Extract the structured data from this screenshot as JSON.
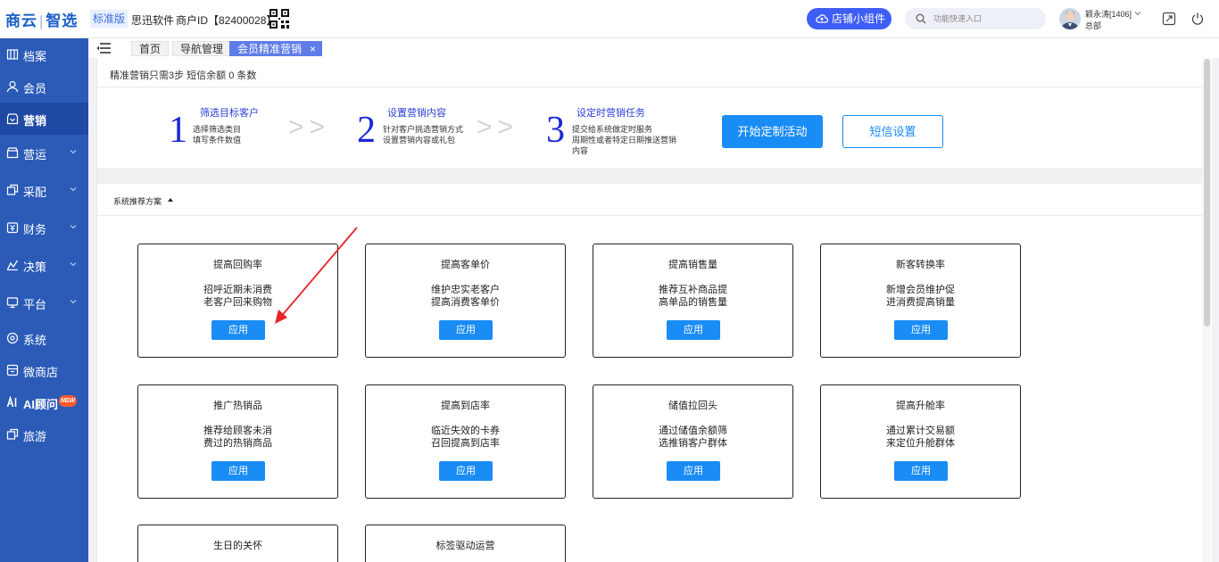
{
  "topbar": {
    "logo_a": "商云",
    "logo_sep": "|",
    "logo_b": "智选",
    "edition": "标准版",
    "company": "思迅软件",
    "merchant": "商户ID【82400028】",
    "widget_label": "店铺小组件",
    "search_placeholder": "功能快速入口",
    "user_name": "颖永涛[1406]",
    "user_dept": "总部"
  },
  "sidebar": {
    "items": [
      {
        "label": "档案",
        "icon": "archive-icon"
      },
      {
        "label": "会员",
        "icon": "user-icon"
      },
      {
        "label": "营销",
        "icon": "marketing-icon"
      },
      {
        "label": "营运",
        "icon": "operations-icon"
      },
      {
        "label": "采配",
        "icon": "purchase-icon"
      },
      {
        "label": "财务",
        "icon": "finance-icon"
      },
      {
        "label": "决策",
        "icon": "decision-icon"
      },
      {
        "label": "平台",
        "icon": "platform-icon"
      },
      {
        "label": "系统",
        "icon": "system-icon"
      },
      {
        "label": "微商店",
        "icon": "microstore-icon"
      },
      {
        "label": "AI顾问",
        "icon": "ai-icon"
      },
      {
        "label": "旅游",
        "icon": "travel-icon"
      }
    ],
    "new_badge": "NEW"
  },
  "tabs": {
    "home": "首页",
    "nav": "导航管理",
    "current": "会员精准营销",
    "close": "×"
  },
  "summary": "精准营销只需3步  短信余额 0 条数",
  "steps": [
    {
      "num": "1",
      "title": "筛选目标客户",
      "desc1": "选择筛选类目",
      "desc2": "填写条件数值"
    },
    {
      "num": "2",
      "title": "设置营销内容",
      "desc1": "针对客户挑选营销方式",
      "desc2": "设置营销内容或礼包"
    },
    {
      "num": "3",
      "title": "设定时营销任务",
      "desc1": "提交给系统做定时服务",
      "desc2": "周期性或者特定日期推送营销",
      "desc3": "内容"
    }
  ],
  "arrows": ">>",
  "buttons": {
    "start": "开始定制活动",
    "sms": "短信设置"
  },
  "section_title": "系统推荐方案",
  "apply_label": "应用",
  "cards": [
    {
      "title": "提高回购率",
      "line1": "招呼近期未消费",
      "line2": "老客户回来购物"
    },
    {
      "title": "提高客单价",
      "line1": "维护忠实老客户",
      "line2": "提高消费客单价"
    },
    {
      "title": "提高销售量",
      "line1": "推荐互补商品提",
      "line2": "高单品的销售量"
    },
    {
      "title": "新客转换率",
      "line1": "新增会员维护促",
      "line2": "进消费提高销量"
    },
    {
      "title": "推广热销品",
      "line1": "推荐给顾客未消",
      "line2": "费过的热销商品"
    },
    {
      "title": "提高到店率",
      "line1": "临近失效的卡券",
      "line2": "召回提高到店率"
    },
    {
      "title": "储值拉回头",
      "line1": "通过储值余额筛",
      "line2": "选推销客户群体"
    },
    {
      "title": "提高升舱率",
      "line1": "通过累计交易额",
      "line2": "来定位升舱群体"
    },
    {
      "title": "生日的关怀",
      "line1": "",
      "line2": ""
    },
    {
      "title": "标签驱动运营",
      "line1": "",
      "line2": ""
    }
  ],
  "colors": {
    "sidebar_bg": "#2b5bb7",
    "primary": "#1a8cf5",
    "step_number": "#1a28d6",
    "annotation": "#e8232a"
  }
}
